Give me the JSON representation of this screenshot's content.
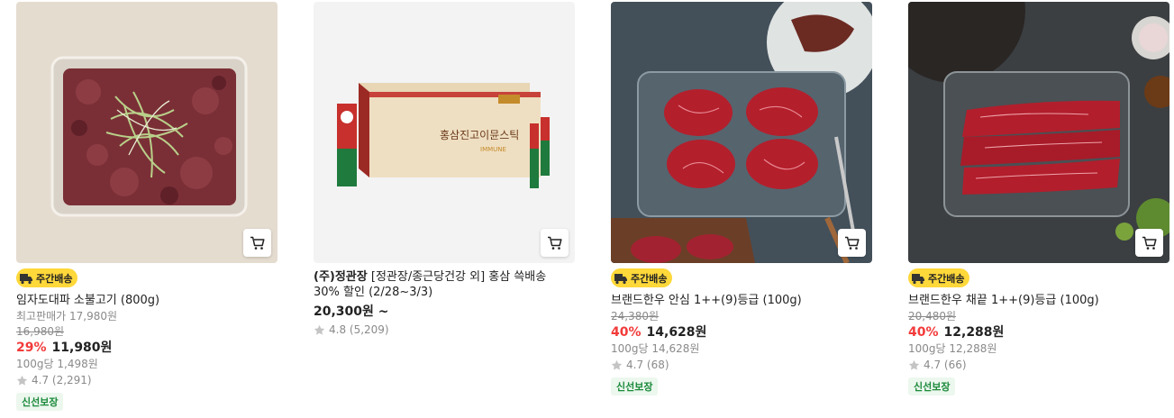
{
  "products": [
    {
      "delivery_badge": "주간배송",
      "name": "임자도대파 소불고기 (800g)",
      "best_price": "최고판매가 17,980원",
      "original_price": "16,980원",
      "discount": "29%",
      "price": "11,980원",
      "unit_price": "100g당 1,498원",
      "rating": "4.7 (2,291)",
      "fresh_badge": "신선보장"
    },
    {
      "brand": "(주)정관장",
      "name": " [정관장/종근당건강 외] 홍삼 쓱배송 30% 할인 (2/28~3/3)",
      "price": "20,300원 ~",
      "rating": "4.8 (5,209)"
    },
    {
      "delivery_badge": "주간배송",
      "name": "브랜드한우 안심 1++(9)등급 (100g)",
      "original_price": "24,380원",
      "discount": "40%",
      "price": "14,628원",
      "unit_price": "100g당 14,628원",
      "rating": "4.7 (68)",
      "fresh_badge": "신선보장"
    },
    {
      "delivery_badge": "주간배송",
      "name": "브랜드한우 채끝 1++(9)등급 (100g)",
      "original_price": "20,480원",
      "discount": "40%",
      "price": "12,288원",
      "unit_price": "100g당 12,288원",
      "rating": "4.7 (66)",
      "fresh_badge": "신선보장"
    }
  ],
  "colors": {
    "discount": "#f23a3a",
    "delivery_badge_bg": "#ffd83a",
    "fresh_text": "#1a8a3a"
  },
  "icons": {
    "cart": "cart-icon",
    "star": "star-icon",
    "truck": "delivery-truck-icon"
  }
}
